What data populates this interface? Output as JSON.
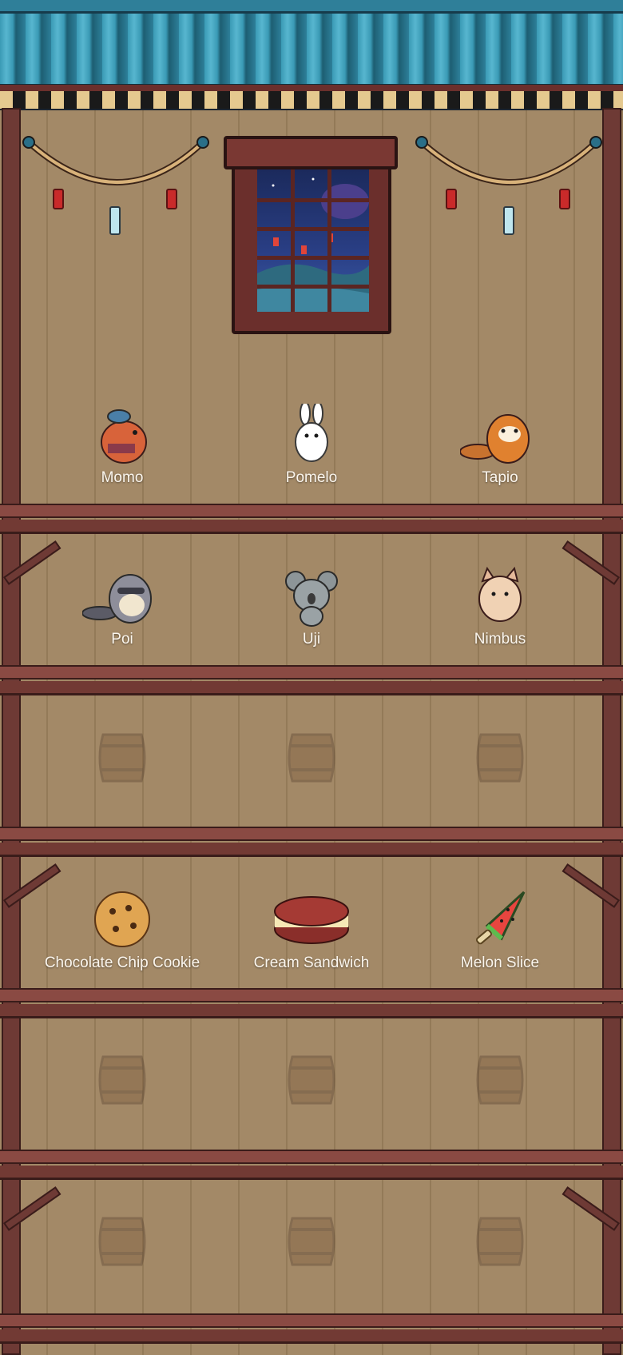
{
  "shelf_rows": [
    {
      "kind": "creature",
      "items": [
        {
          "name": "Momo",
          "icon": "capybara-icon"
        },
        {
          "name": "Pomelo",
          "icon": "bunny-icon"
        },
        {
          "name": "Tapio",
          "icon": "red-panda-icon"
        }
      ]
    },
    {
      "kind": "creature",
      "items": [
        {
          "name": "Poi",
          "icon": "raccoon-icon"
        },
        {
          "name": "Uji",
          "icon": "koala-icon"
        },
        {
          "name": "Nimbus",
          "icon": "cat-icon"
        }
      ]
    },
    {
      "kind": "empty",
      "items": [
        {
          "name": "",
          "icon": "barrel-icon"
        },
        {
          "name": "",
          "icon": "barrel-icon"
        },
        {
          "name": "",
          "icon": "barrel-icon"
        }
      ]
    },
    {
      "kind": "snack",
      "items": [
        {
          "name": "Chocolate Chip Cookie",
          "icon": "cookie-icon"
        },
        {
          "name": "Cream Sandwich",
          "icon": "cream-sandwich-icon"
        },
        {
          "name": "Melon Slice",
          "icon": "melon-popsicle-icon"
        }
      ]
    },
    {
      "kind": "empty",
      "items": [
        {
          "name": "",
          "icon": "barrel-icon"
        },
        {
          "name": "",
          "icon": "barrel-icon"
        },
        {
          "name": "",
          "icon": "barrel-icon"
        }
      ]
    },
    {
      "kind": "empty",
      "items": [
        {
          "name": "",
          "icon": "barrel-icon"
        },
        {
          "name": "",
          "icon": "barrel-icon"
        },
        {
          "name": "",
          "icon": "barrel-icon"
        }
      ]
    }
  ],
  "colors": {
    "wall": "#a38967",
    "wood_dark": "#6e3a35",
    "roof_tile": "#3a9ab5",
    "label_text": "#fbf6ee"
  }
}
